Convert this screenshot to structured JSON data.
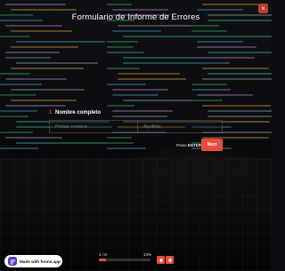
{
  "form": {
    "title": "Formulario de Informe de Errores",
    "close_label": "×",
    "question_number": "1",
    "question_label": "Nombre completo",
    "first_name_placeholder": "Primer nombre",
    "last_name_placeholder": "Apellido",
    "press_hint": "Press",
    "press_key": "ENTER",
    "next_label": "Next"
  },
  "progress": {
    "counter": "1 / 8",
    "percent_label": "13%",
    "value": 0.13
  },
  "badge": {
    "text": "Made with forms.app"
  },
  "colors": {
    "accent": "#e74c3c",
    "badge_logo": "#5b3cc4"
  }
}
